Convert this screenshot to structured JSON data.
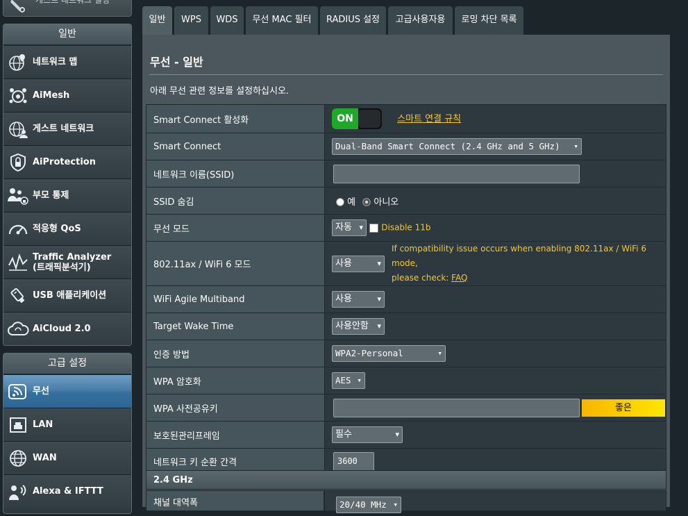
{
  "sidebar": {
    "top_partial_label": "게스트 네트워크 설정",
    "general_header": "일반",
    "general_items": [
      {
        "label": "네트워크 맵",
        "icon": "network-map-icon"
      },
      {
        "label": "AiMesh",
        "icon": "aimesh-icon"
      },
      {
        "label": "게스트 네트워크",
        "icon": "guest-network-icon"
      },
      {
        "label": "AiProtection",
        "icon": "shield-icon"
      },
      {
        "label": "부모 통제",
        "icon": "parental-control-icon"
      },
      {
        "label": "적응형 QoS",
        "icon": "qos-gauge-icon"
      },
      {
        "label": "Traffic Analyzer",
        "label2": "(트래픽분석기)",
        "icon": "traffic-analyzer-icon"
      },
      {
        "label": "USB 애플리케이션",
        "icon": "usb-icon"
      },
      {
        "label": "AiCloud 2.0",
        "icon": "cloud-icon"
      }
    ],
    "advanced_header": "고급 설정",
    "advanced_items": [
      {
        "label": "무선",
        "icon": "wireless-icon",
        "active": true
      },
      {
        "label": "LAN",
        "icon": "lan-icon"
      },
      {
        "label": "WAN",
        "icon": "wan-globe-icon"
      },
      {
        "label": "Alexa & IFTTT",
        "icon": "alexa-icon"
      }
    ]
  },
  "tabs": [
    "일반",
    "WPS",
    "WDS",
    "무선 MAC 필터",
    "RADIUS 설정",
    "고급사용자용",
    "로밍 차단 목록"
  ],
  "main": {
    "title": "무선 - 일반",
    "description": "아래 무선 관련 정보를 설정하십시오.",
    "rows": {
      "smart_connect_enable": {
        "label": "Smart Connect 활성화",
        "toggle": "ON",
        "link": "스마트 연결 규칙"
      },
      "smart_connect": {
        "label": "Smart Connect",
        "value": "Dual-Band Smart Connect (2.4 GHz and 5 GHz)"
      },
      "ssid": {
        "label": "네트워크 이름(SSID)",
        "value": ""
      },
      "hide_ssid": {
        "label": "SSID 숨김",
        "opt_yes": "예",
        "opt_no": "아니오",
        "selected": "아니오"
      },
      "wireless_mode": {
        "label": "무선 모드",
        "value": "자동",
        "checkbox_label": "Disable 11b"
      },
      "ax_mode": {
        "label": "802.11ax / WiFi 6 모드",
        "value": "사용",
        "note": "If compatibility issue occurs when enabling 802.11ax / WiFi 6 mode,",
        "note2": "please check: ",
        "note_link": "FAQ"
      },
      "agile_multiband": {
        "label": "WiFi Agile Multiband",
        "value": "사용"
      },
      "target_wake": {
        "label": "Target Wake Time",
        "value": "사용안함"
      },
      "auth_method": {
        "label": "인증 방법",
        "value": "WPA2-Personal"
      },
      "wpa_encryption": {
        "label": "WPA 암호화",
        "value": "AES"
      },
      "wpa_psk": {
        "label": "WPA 사전공유키",
        "value": "",
        "strength": "좋은"
      },
      "pmf": {
        "label": "보호된관리프레임",
        "value": "필수"
      },
      "key_rotation": {
        "label": "네트워크 키 순환 간격",
        "value": "3600"
      }
    },
    "section_24": "2.4 GHz",
    "channel_bw": {
      "label": "채널 대역폭",
      "value": "20/40 MHz"
    }
  },
  "colors": {
    "accent_yellow": "#fcc620",
    "toggle_green": "#20a82b",
    "active_nav": "#3f77a3"
  }
}
